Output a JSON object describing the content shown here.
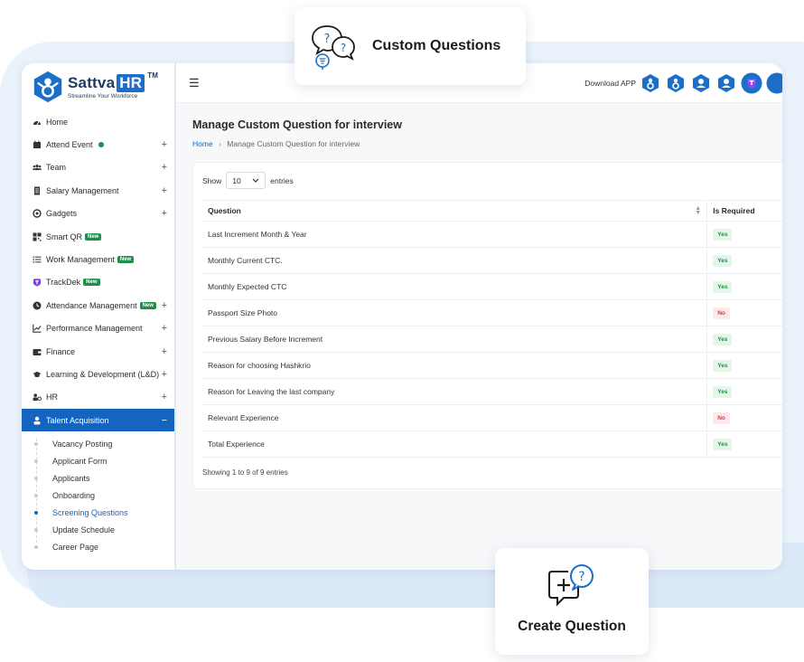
{
  "brand": {
    "name": "Sattva",
    "name_highlight": "HR",
    "trademark": "TM",
    "tagline": "Streamline Your Workforce",
    "accent_color": "#1565c0",
    "success_color": "#1d8f4b",
    "danger_color": "#d33a4a"
  },
  "callouts": {
    "top": "Custom Questions",
    "bottom": "Create Question"
  },
  "sidebar": {
    "items": [
      {
        "label": "Home",
        "icon": "dashboard-icon",
        "expandable": false
      },
      {
        "label": "Attend Event",
        "icon": "calendar-icon",
        "expandable": true,
        "status_dot": true
      },
      {
        "label": "Team",
        "icon": "team-icon",
        "expandable": true
      },
      {
        "label": "Salary Management",
        "icon": "document-icon",
        "expandable": true
      },
      {
        "label": "Gadgets",
        "icon": "gadget-icon",
        "expandable": true
      },
      {
        "label": "Smart QR",
        "icon": "qr-icon",
        "expandable": false,
        "badge": "New"
      },
      {
        "label": "Work Management",
        "icon": "list-icon",
        "expandable": false,
        "badge": "New"
      },
      {
        "label": "TrackDek",
        "icon": "trackdek-icon",
        "expandable": false,
        "badge": "New"
      },
      {
        "label": "Attendance Management",
        "icon": "clock-icon",
        "expandable": true,
        "badge": "New"
      },
      {
        "label": "Performance Management",
        "icon": "chart-icon",
        "expandable": true
      },
      {
        "label": "Finance",
        "icon": "wallet-icon",
        "expandable": true
      },
      {
        "label": "Learning & Development (L&D)",
        "icon": "graduation-icon",
        "expandable": true
      },
      {
        "label": "HR",
        "icon": "hr-icon",
        "expandable": true
      },
      {
        "label": "Talent Acquisition",
        "icon": "user-icon",
        "expandable": true,
        "active": true,
        "collapse_symbol": "−"
      }
    ],
    "expand_symbol": "+",
    "sub_items": [
      {
        "label": "Vacancy Posting"
      },
      {
        "label": "Applicant Form"
      },
      {
        "label": "Applicants"
      },
      {
        "label": "Onboarding"
      },
      {
        "label": "Screening Questions",
        "current": true
      },
      {
        "label": "Update Schedule"
      },
      {
        "label": "Career Page"
      }
    ]
  },
  "topbar": {
    "download_label": "Download APP"
  },
  "page": {
    "title": "Manage Custom Question for interview",
    "breadcrumb": {
      "home": "Home",
      "separator": "›",
      "current": "Manage Custom Question for interview"
    }
  },
  "table": {
    "show_label": "Show",
    "entries_value": "10",
    "entries_label": "entries",
    "columns": [
      "Question",
      "Is Required"
    ],
    "rows": [
      {
        "question": "Last Increment Month & Year",
        "required": "Yes"
      },
      {
        "question": "Monthly Current CTC.",
        "required": "Yes"
      },
      {
        "question": "Monthly Expected CTC",
        "required": "Yes"
      },
      {
        "question": "Passport Size Photo",
        "required": "No"
      },
      {
        "question": "Previous Salary Before Increment",
        "required": "Yes"
      },
      {
        "question": "Reason for choosing Hashkrio",
        "required": "Yes"
      },
      {
        "question": "Reason for Leaving the last company",
        "required": "Yes"
      },
      {
        "question": "Relevant Experience",
        "required": "No"
      },
      {
        "question": "Total Experience",
        "required": "Yes"
      }
    ],
    "footer": "Showing 1 to 9 of 9 entries"
  }
}
